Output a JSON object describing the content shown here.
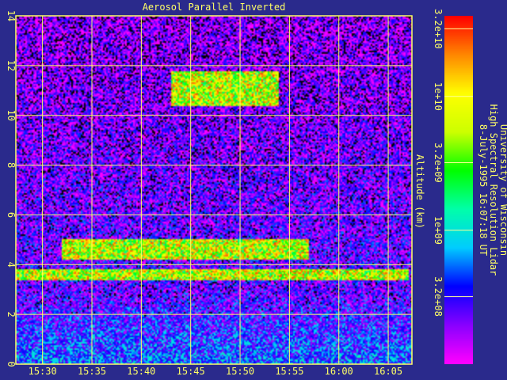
{
  "chart_data": {
    "type": "heatmap",
    "title": "Aerosol Parallel Inverted",
    "xlabel": "",
    "ylabel": "Altitude (km)",
    "x_ticks": [
      "15:30",
      "15:35",
      "15:40",
      "15:45",
      "15:50",
      "15:55",
      "16:00",
      "16:05"
    ],
    "y_ticks": [
      "0",
      "2",
      "4",
      "6",
      "8",
      "10",
      "12",
      "14"
    ],
    "ylim": [
      0,
      14
    ],
    "grid": true,
    "colorbar": {
      "scale": "log",
      "range": [
        100000000.0,
        40000000000.0
      ],
      "ticks": [
        "3.2e+08",
        "1e+09",
        "3.2e+09",
        "1e+10",
        "3.2e+10"
      ],
      "colors": [
        "#ff00ff",
        "#8800ff",
        "#0000ff",
        "#00ccff",
        "#00ffaa",
        "#00ff00",
        "#ccff00",
        "#ffff00",
        "#ff8800",
        "#ff0000"
      ]
    },
    "features": [
      {
        "name": "aerosol layer",
        "altitude_km": [
          3.4,
          3.8
        ],
        "time": [
          "15:27",
          "16:07"
        ]
      },
      {
        "name": "cloud layer",
        "altitude_km": [
          4.2,
          5.0
        ],
        "time": [
          "15:32",
          "15:57"
        ]
      },
      {
        "name": "thin cirrus",
        "altitude_km": [
          10.4,
          11.8
        ],
        "time": [
          "15:43",
          "15:54"
        ]
      }
    ]
  },
  "info": {
    "line1": "University of Wisconsin",
    "line2": "High Spectral Resolution Lidar",
    "line3": "8-July-1995 16:07:18 UT"
  }
}
